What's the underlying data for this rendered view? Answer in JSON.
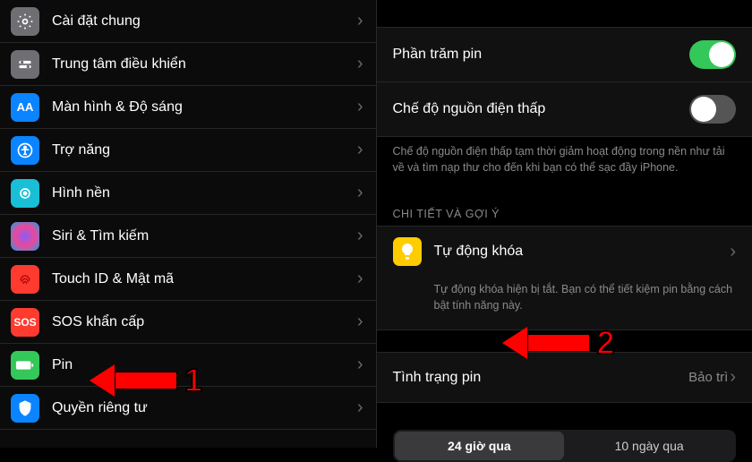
{
  "left": {
    "items": [
      {
        "label": "Cài đặt chung",
        "icon": "gear-icon",
        "bg": "#6e6e73"
      },
      {
        "label": "Trung tâm điều khiển",
        "icon": "control-center-icon",
        "bg": "#6e6e73"
      },
      {
        "label": "Màn hình & Độ sáng",
        "icon": "display-icon",
        "bg": "#0a84ff"
      },
      {
        "label": "Trợ năng",
        "icon": "accessibility-icon",
        "bg": "#0a84ff"
      },
      {
        "label": "Hình nền",
        "icon": "wallpaper-icon",
        "bg": "#18bfd6"
      },
      {
        "label": "Siri & Tìm kiếm",
        "icon": "siri-icon",
        "bg": "#1c1c1e"
      },
      {
        "label": "Touch ID & Mật mã",
        "icon": "fingerprint-icon",
        "bg": "#ff3b30"
      },
      {
        "label": "SOS khẩn cấp",
        "icon": "sos-icon",
        "bg": "#ff3b30"
      },
      {
        "label": "Pin",
        "icon": "battery-icon",
        "bg": "#34c759"
      },
      {
        "label": "Quyền riêng tư",
        "icon": "privacy-icon",
        "bg": "#0a84ff"
      }
    ]
  },
  "right": {
    "battery_percent_label": "Phần trăm pin",
    "battery_percent_on": true,
    "low_power_label": "Chế độ nguồn điện thấp",
    "low_power_on": false,
    "low_power_note": "Chế độ nguồn điện thấp tạm thời giảm hoạt động trong nền như tải về và tìm nạp thư cho đến khi bạn có thể sạc đầy iPhone.",
    "tips_header": "CHI TIẾT VÀ GỢI Ý",
    "tip_title": "Tự động khóa",
    "tip_desc": "Tự động khóa hiện bị tắt. Bạn có thể tiết kiệm pin bằng cách bật tính năng này.",
    "health_label": "Tình trạng pin",
    "health_value": "Bảo trì",
    "seg_a": "24 giờ qua",
    "seg_b": "10 ngày qua"
  },
  "annotations": {
    "num1": "1",
    "num2": "2"
  }
}
